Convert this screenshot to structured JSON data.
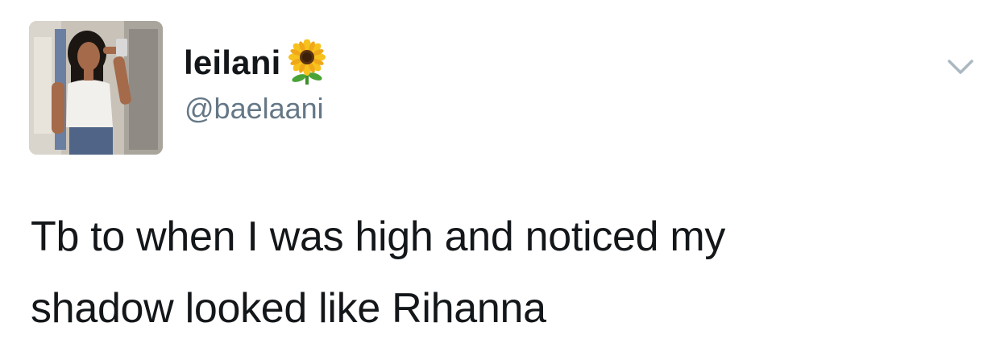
{
  "tweet": {
    "display_name": "leilani",
    "name_emoji": "sunflower-icon",
    "handle": "@baelaani",
    "text_line_1": "Tb to when I was high and noticed my",
    "text_line_2": "shadow looked like Rihanna"
  },
  "colors": {
    "text": "#14171a",
    "secondary": "#657786",
    "caret": "#aab8c2"
  }
}
